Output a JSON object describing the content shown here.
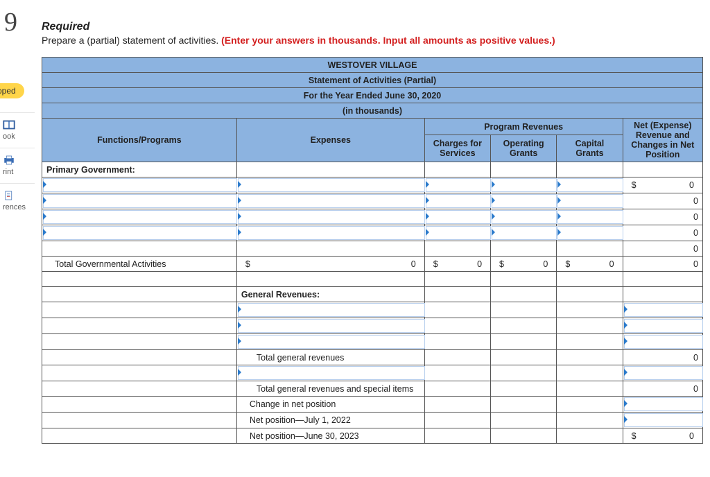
{
  "question_number": "9",
  "required_label": "Required",
  "instruction_plain": "Prepare a (partial) statement of activities. ",
  "instruction_red": "(Enter your answers in thousands. Input all amounts as positive values.)",
  "sidebar": {
    "pill": "oped",
    "book": "ook",
    "print": "rint",
    "references": "rences"
  },
  "header": {
    "line1": "WESTOVER VILLAGE",
    "line2": "Statement of Activities (Partial)",
    "line3": "For the Year Ended June 30, 2020",
    "line4": "(in thousands)"
  },
  "columns": {
    "functions": "Functions/Programs",
    "expenses": "Expenses",
    "program_revenues": "Program Revenues",
    "charges": "Charges for Services",
    "operating": "Operating Grants",
    "capital": "Capital Grants",
    "net": "Net (Expense) Revenue and Changes in Net Position"
  },
  "rows": {
    "primary_gov": "Primary Government:",
    "total_gov": "Total Governmental Activities",
    "general_rev": "General Revenues:",
    "total_gen_rev": "Total general revenues",
    "total_gen_rev_special": "Total general revenues and special items",
    "change_net": "Change in net position",
    "net_pos_begin": "Net position—July 1, 2022",
    "net_pos_end": "Net position—June 30, 2023"
  },
  "vals": {
    "dollar": "$",
    "zero": "0"
  }
}
